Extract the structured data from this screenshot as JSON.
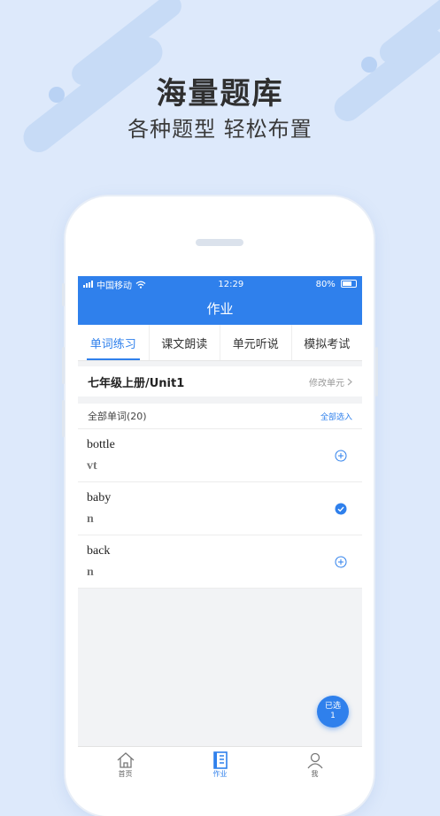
{
  "promo": {
    "headline": "海量题库",
    "subline": "各种题型  轻松布置"
  },
  "status_bar": {
    "carrier": "中国移动",
    "time": "12:29",
    "battery": "80%"
  },
  "nav": {
    "title": "作业"
  },
  "tabs": [
    {
      "label": "单词练习",
      "active": true
    },
    {
      "label": "课文朗读",
      "active": false
    },
    {
      "label": "单元听说",
      "active": false
    },
    {
      "label": "模拟考试",
      "active": false
    }
  ],
  "unit": {
    "title": "七年级上册/Unit1",
    "edit_label": "修改单元"
  },
  "list": {
    "header": "全部单词(20)",
    "select_all": "全部选入"
  },
  "words": [
    {
      "word": "bottle",
      "pos": "vt",
      "state": "add"
    },
    {
      "word": "baby",
      "pos": "n",
      "state": "checked"
    },
    {
      "word": "back",
      "pos": "n",
      "state": "add"
    }
  ],
  "fab": {
    "line1": "已选",
    "line2": "1"
  },
  "bottom_nav": [
    {
      "label": "首页",
      "icon": "home-icon",
      "active": false
    },
    {
      "label": "作业",
      "icon": "homework-icon",
      "active": true
    },
    {
      "label": "我",
      "icon": "profile-icon",
      "active": false
    }
  ],
  "colors": {
    "accent": "#2f80ec",
    "background": "#dde9fb"
  }
}
